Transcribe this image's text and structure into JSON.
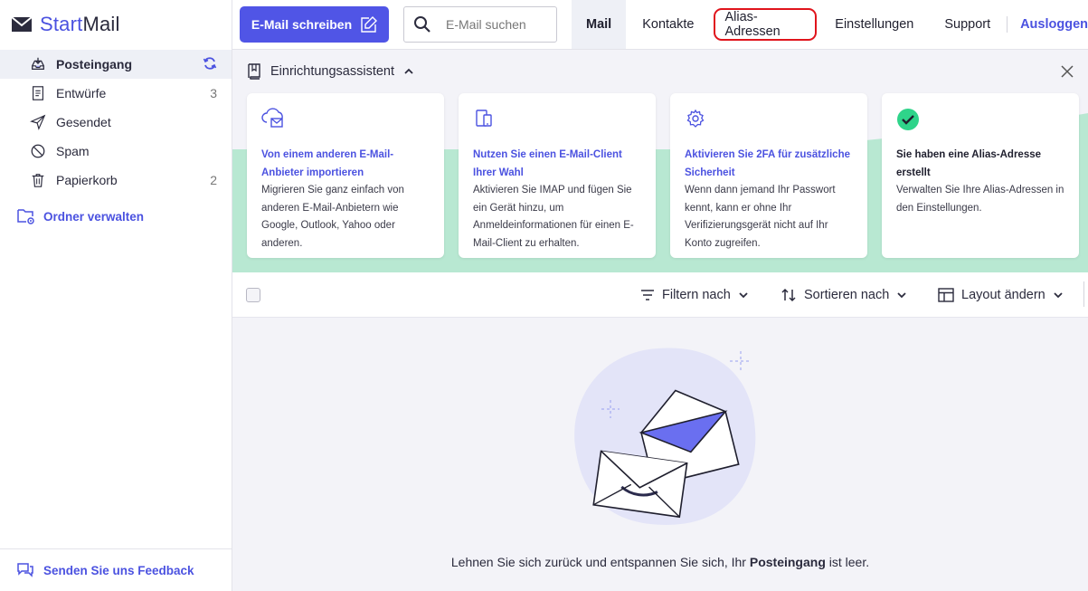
{
  "brand": {
    "name_part1": "Start",
    "name_part2": "Mail"
  },
  "sidebar": {
    "items": [
      {
        "label": "Posteingang",
        "count": "",
        "icon": "inbox-icon",
        "active": true
      },
      {
        "label": "Entwürfe",
        "count": "3",
        "icon": "drafts-icon"
      },
      {
        "label": "Gesendet",
        "count": "",
        "icon": "send-icon"
      },
      {
        "label": "Spam",
        "count": "",
        "icon": "spam-icon"
      },
      {
        "label": "Papierkorb",
        "count": "2",
        "icon": "trash-icon"
      }
    ],
    "manage_label": "Ordner verwalten",
    "feedback_label": "Senden Sie uns Feedback"
  },
  "header": {
    "compose_label": "E-Mail schreiben",
    "search_placeholder": "E-Mail suchen",
    "tabs": {
      "mail": "Mail",
      "contacts": "Kontakte",
      "alias": "Alias-Adressen",
      "settings": "Einstellungen",
      "support": "Support",
      "logout": "Ausloggen"
    }
  },
  "wizard": {
    "title": "Einrichtungsassistent",
    "cards": [
      {
        "title": "Von einem anderen E-Mail-Anbieter importieren",
        "desc": "Migrieren Sie ganz einfach von anderen E-Mail-Anbietern wie Google, Outlook, Yahoo oder anderen.",
        "icon": "cloud-mail-icon"
      },
      {
        "title": "Nutzen Sie einen E-Mail-Client Ihrer Wahl",
        "desc": "Aktivieren Sie IMAP und fügen Sie ein Gerät hinzu, um Anmeldeinformationen für einen E-Mail-Client zu erhalten.",
        "icon": "devices-icon"
      },
      {
        "title": "Aktivieren Sie 2FA für zusätzliche Sicherheit",
        "desc": "Wenn dann jemand Ihr Passwort kennt, kann er ohne Ihr Verifizierungsgerät nicht auf Ihr Konto zugreifen.",
        "icon": "gear-icon"
      },
      {
        "title": "Sie haben eine Alias-Adresse erstellt",
        "desc": "Verwalten Sie Ihre Alias-Adressen in den Einstellungen.",
        "icon": "check-circle-icon"
      }
    ]
  },
  "toolbar": {
    "filter_label": "Filtern nach",
    "sort_label": "Sortieren nach",
    "layout_label": "Layout ändern"
  },
  "empty": {
    "text_before": "Lehnen Sie sich zurück und entspannen Sie sich, Ihr ",
    "text_bold": "Posteingang",
    "text_after": " ist leer."
  },
  "colors": {
    "accent": "#5055e6",
    "green": "#b8e8d2",
    "check": "#2fd48a",
    "highlight": "#e0141c"
  }
}
